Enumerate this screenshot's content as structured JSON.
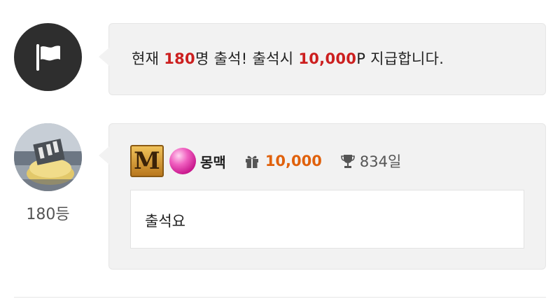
{
  "notice": {
    "prefix": "현재 ",
    "count": "180",
    "middle": "명 출석! 출석시 ",
    "points": "10,000",
    "suffix": "P 지급합니다.",
    "icon": "flag-icon"
  },
  "comment": {
    "rank": "180등",
    "badge_letter": "M",
    "nickname": "몽맥",
    "points": "10,000",
    "days": "834일",
    "text": "출석요",
    "icons": [
      "gift-icon",
      "trophy-icon"
    ]
  },
  "colors": {
    "highlight_red": "#cc1f1f",
    "points_orange": "#e0610c",
    "bubble_bg": "#f2f2f2",
    "dark_avatar": "#2e2e2e"
  }
}
